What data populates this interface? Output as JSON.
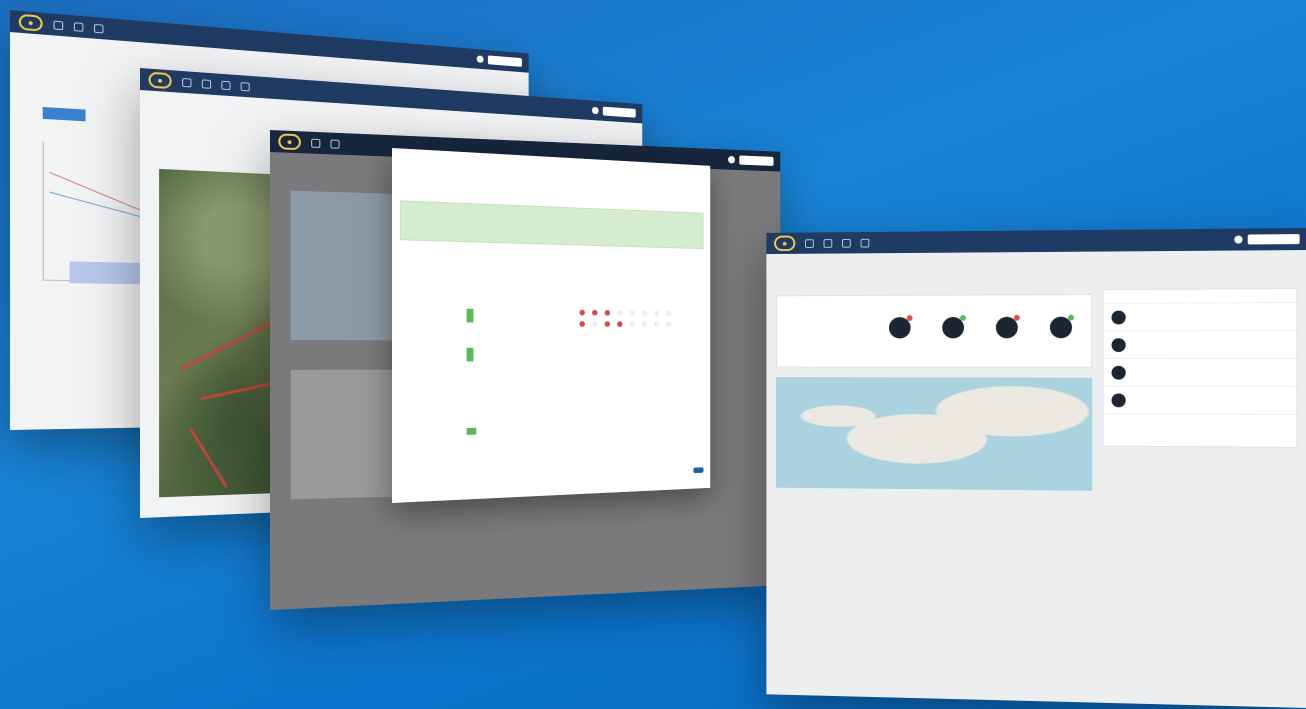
{
  "windows": {
    "w1": {
      "title": "",
      "brand_color": "#1f3a63"
    },
    "w2": {
      "title": "",
      "route_color": "#c8423b"
    },
    "w3": {
      "title": ""
    },
    "modal": {
      "title": "",
      "alert": "",
      "alert_sub": "",
      "tabs": [
        "",
        "",
        "",
        "",
        "",
        ""
      ],
      "right_title": "",
      "row_marks": [
        "red",
        "red",
        "red",
        "",
        "",
        "",
        "",
        ""
      ],
      "row_marks_2": [
        "red",
        "",
        "red",
        "red",
        "",
        "",
        "",
        ""
      ],
      "ok_label": ""
    },
    "dashboard": {
      "title": "",
      "stats": [
        "",
        ""
      ],
      "circles": [
        {
          "label": "",
          "badge_color": "#e05050"
        },
        {
          "label": "",
          "badge_color": "#5bb85c"
        },
        {
          "label": "",
          "badge_color": "#e05050"
        },
        {
          "label": "",
          "badge_color": "#5bb85c"
        }
      ],
      "activity": [
        {
          "title": "",
          "sub": "",
          "right": ""
        },
        {
          "title": "",
          "sub": "",
          "right": ""
        },
        {
          "title": "",
          "sub": "",
          "right": ""
        },
        {
          "title": "",
          "sub": "",
          "right": ""
        }
      ],
      "more_label": ""
    }
  },
  "colors": {
    "background": "#1883d6",
    "topbar": "#1f3a63",
    "success": "#5bb85c",
    "danger": "#d34a4a"
  }
}
